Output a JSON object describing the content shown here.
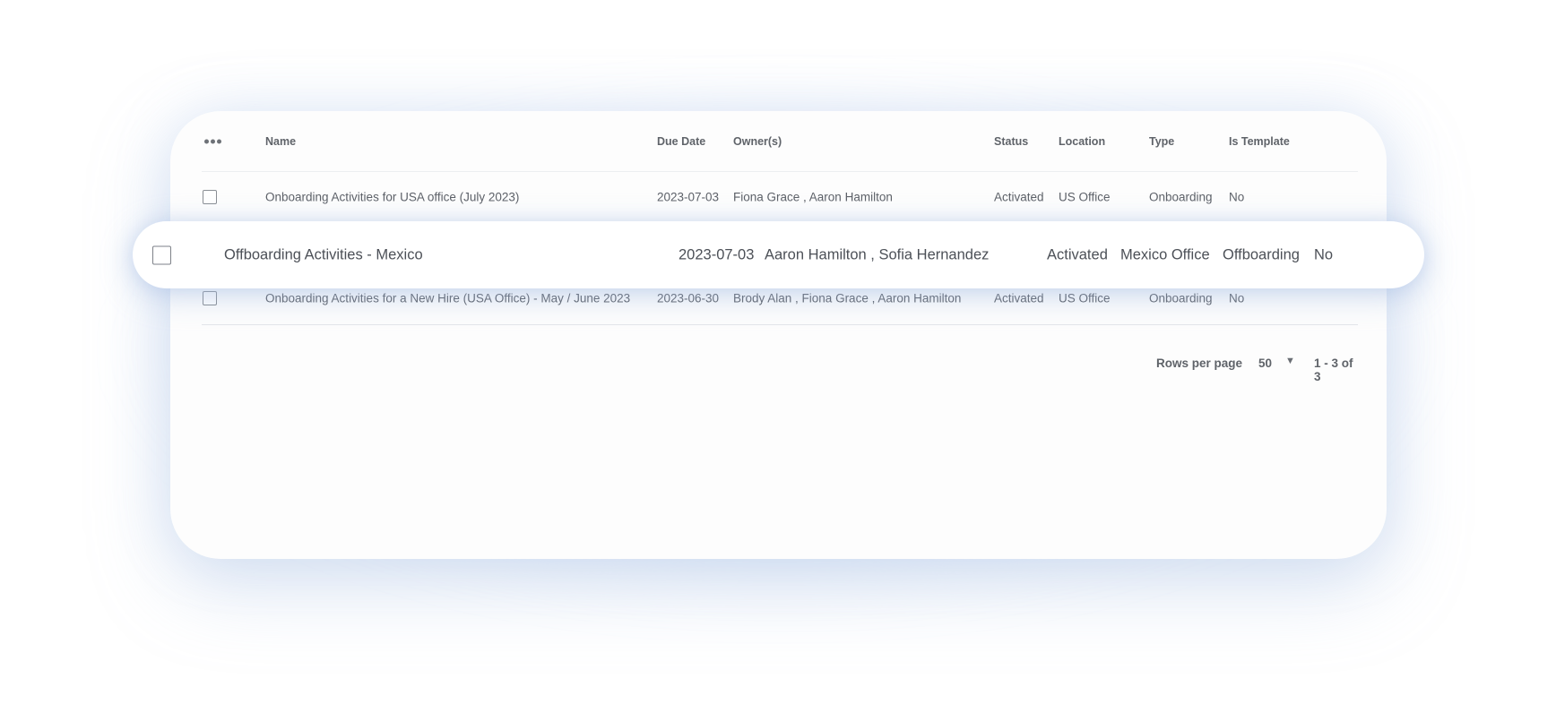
{
  "table": {
    "columns": {
      "name": "Name",
      "due_date": "Due Date",
      "owners": "Owner(s)",
      "status": "Status",
      "location": "Location",
      "type": "Type",
      "is_template": "Is Template"
    },
    "rows": [
      {
        "name": "Onboarding Activities for USA office (July 2023)",
        "due_date": "2023-07-03",
        "owners": "Fiona Grace , Aaron Hamilton",
        "status": "Activated",
        "location": "US Office",
        "type": "Onboarding",
        "is_template": "No"
      },
      {
        "name": "Offboarding Activities - Mexico",
        "due_date": "2023-07-03",
        "owners": "Aaron Hamilton , Sofia Hernandez",
        "status": "Activated",
        "location": "Mexico Office",
        "type": "Offboarding",
        "is_template": "No",
        "highlighted": true
      },
      {
        "name": "Onboarding Activities for a New Hire (USA Office) - May / June 2023",
        "due_date": "2023-06-30",
        "owners": "Brody Alan , Fiona Grace , Aaron Hamilton",
        "status": "Activated",
        "location": "US Office",
        "type": "Onboarding",
        "is_template": "No"
      }
    ]
  },
  "pagination": {
    "rows_per_page_label": "Rows per page",
    "rows_per_page_value": "50",
    "range_text": "1 - 3 of 3"
  },
  "icons": {
    "menu": "more-horizontal-icon",
    "dropdown": "caret-down-icon",
    "checkbox": "checkbox-icon"
  }
}
